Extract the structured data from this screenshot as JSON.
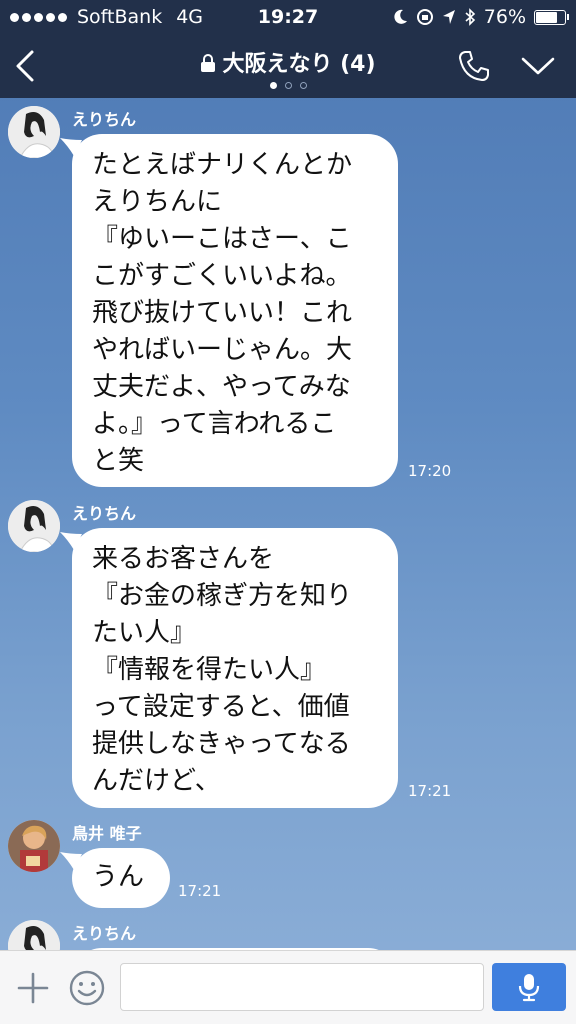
{
  "status_bar": {
    "carrier": "SoftBank",
    "network": "4G",
    "time": "19:27",
    "battery_text": "76%",
    "battery_level": 0.76
  },
  "header": {
    "title": "大阪えなり (4)",
    "page_count": 3,
    "current_page": 1
  },
  "messages": [
    {
      "sender": "えりちん",
      "lines": [
        "たとえばナリくんとか",
        "えりちんに",
        "『ゆいーこはさー、こ",
        "こがすごくいいよね。",
        "飛び抜けていい！これ",
        "やればいーじゃん。大",
        "丈夫だよ、やってみな",
        "よ。』って言われるこ",
        "と笑"
      ],
      "time": "17:20"
    },
    {
      "sender": "えりちん",
      "lines": [
        "来るお客さんを",
        "『お金の稼ぎ方を知り",
        "たい人』",
        "『情報を得たい人』",
        "って設定すると、価値",
        "提供しなきゃってなる",
        "んだけど、"
      ],
      "time": "17:21"
    },
    {
      "sender": "鳥井 唯子",
      "lines": [
        "うん"
      ],
      "time": "17:21"
    },
    {
      "sender": "えりちん",
      "lines": [],
      "time": ""
    }
  ],
  "composer": {
    "placeholder": "",
    "value": ""
  },
  "colors": {
    "bar_background": "#22304a",
    "chat_background": "#5f8bc2",
    "send_button": "#3f7fde"
  }
}
